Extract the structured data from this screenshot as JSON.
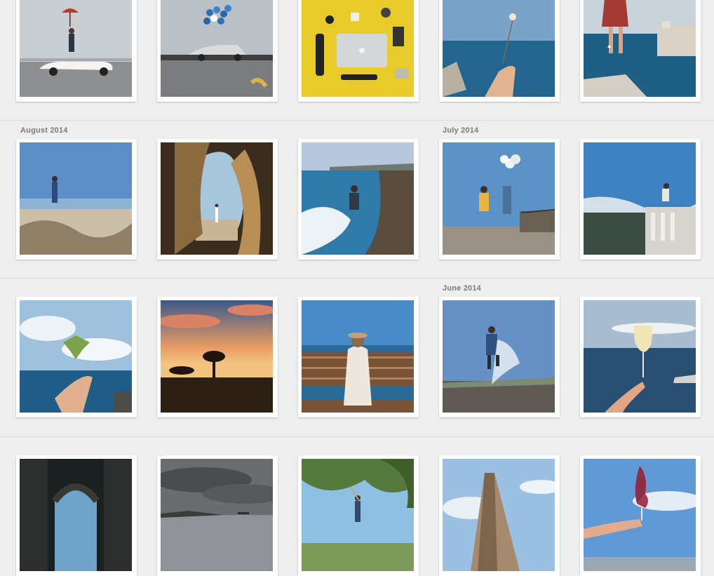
{
  "sections": {
    "august_2014": "August 2014",
    "july_2014": "July 2014",
    "june_2014": "June 2014"
  }
}
